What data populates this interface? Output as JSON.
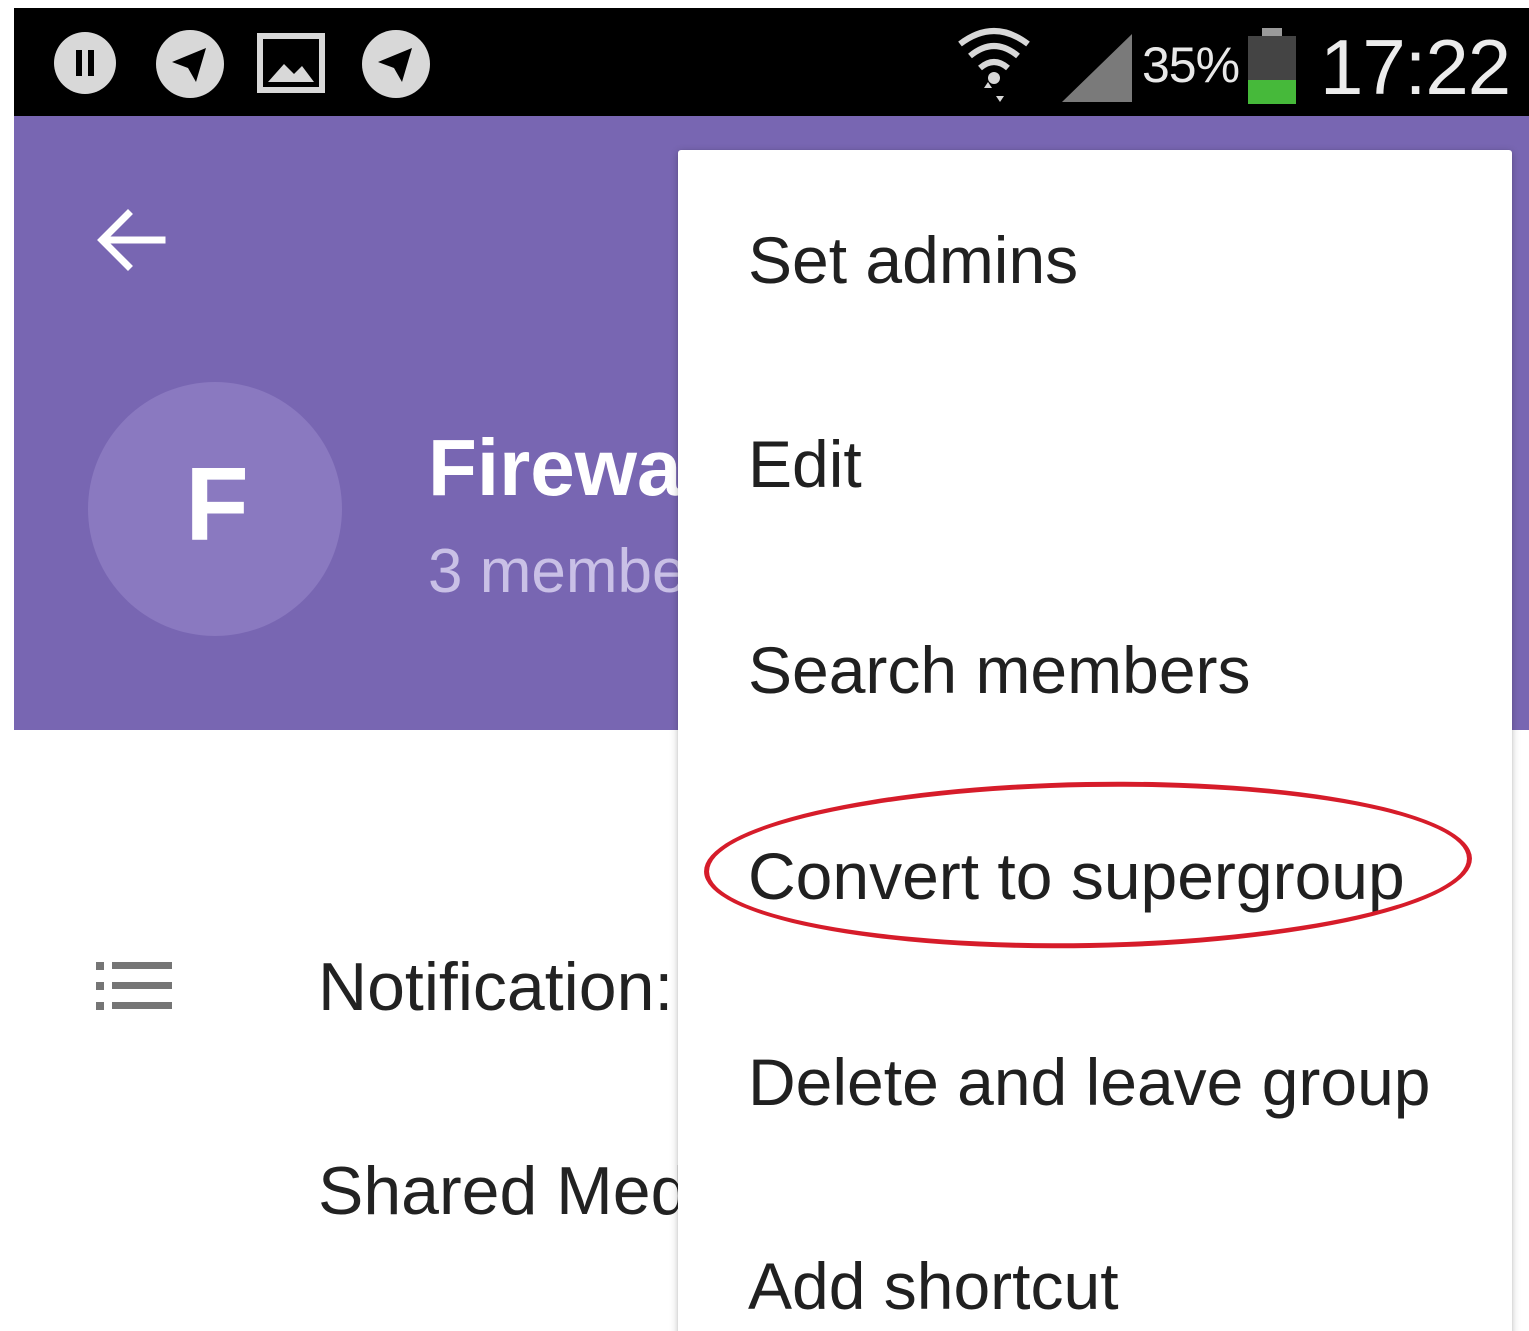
{
  "status_bar": {
    "icons": [
      "pause-icon",
      "telegram-icon",
      "image-icon",
      "telegram-icon",
      "wifi-icon",
      "signal-icon",
      "battery-icon"
    ],
    "battery_percent": "35%",
    "time": "17:22",
    "battery_level": 0.35
  },
  "header": {
    "back_icon": "arrow-back-icon",
    "avatar_letter": "F",
    "group_name": "Firewa",
    "subtitle": "3 membe",
    "color": "#7866b2"
  },
  "content": {
    "notifications_icon": "list-icon",
    "notifications_label": "Notification:",
    "shared_media_label": "Shared Med"
  },
  "menu": {
    "items": [
      {
        "label": "Set admins"
      },
      {
        "label": "Edit"
      },
      {
        "label": "Search members"
      },
      {
        "label": "Convert to supergroup"
      },
      {
        "label": "Delete and leave group"
      },
      {
        "label": "Add shortcut"
      }
    ],
    "highlighted_item": "Convert to supergroup",
    "highlight_color": "#d61c2a"
  }
}
